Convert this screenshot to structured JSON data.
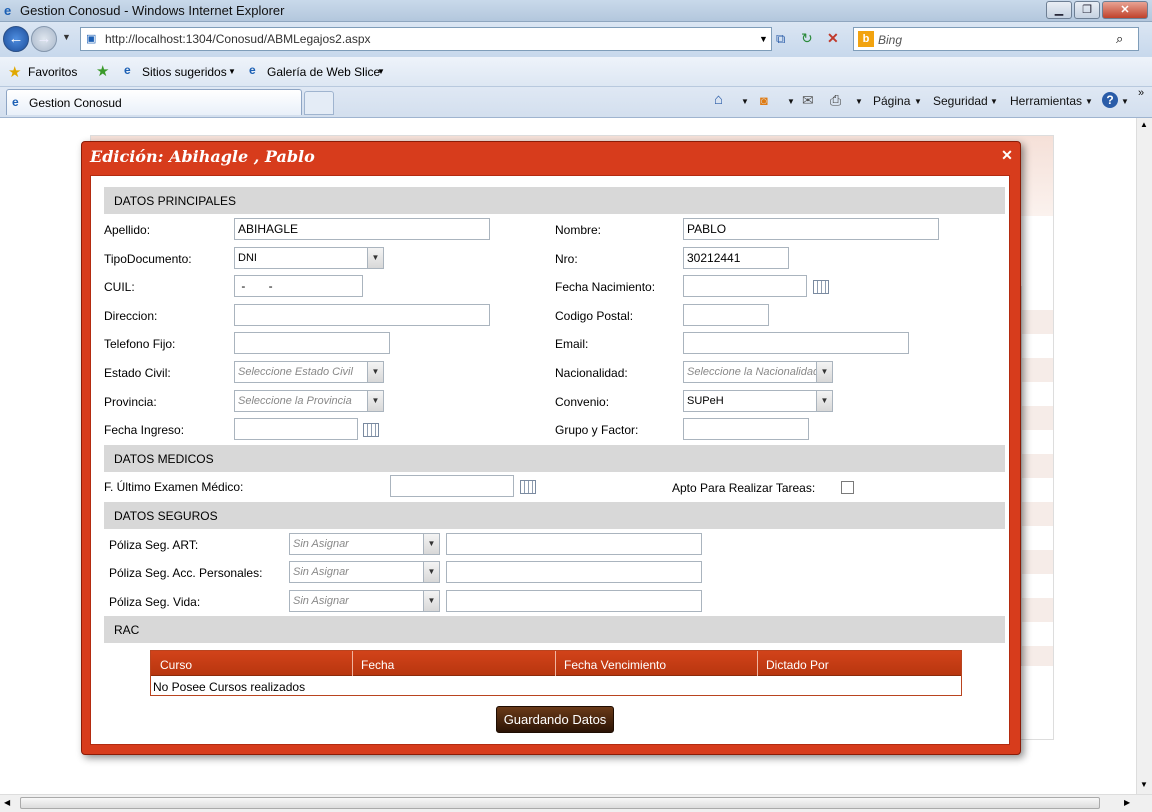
{
  "browser": {
    "window_title": "Gestion Conosud - Windows Internet Explorer",
    "url": "http://localhost:1304/Conosud/ABMLegajos2.aspx",
    "search_placeholder": "Bing",
    "favorites_label": "Favoritos",
    "favlinks": [
      "Sitios sugeridos",
      "Galería de Web Slice"
    ],
    "tab_title": "Gestion Conosud",
    "commands": [
      "Página",
      "Seguridad",
      "Herramientas"
    ]
  },
  "dialog": {
    "title": "Edición: Abihagle , Pablo",
    "sections": {
      "principales": "DATOS PRINCIPALES",
      "medicos": "DATOS MEDICOS",
      "seguros": "DATOS SEGUROS",
      "rac": "RAC"
    },
    "labels": {
      "apellido": "Apellido:",
      "nombre": "Nombre:",
      "tipo_doc": "TipoDocumento:",
      "nro": "Nro:",
      "cuil": "CUIL:",
      "fecha_nac": "Fecha Nacimiento:",
      "direccion": "Direccion:",
      "cp": "Codigo Postal:",
      "telefono": "Telefono Fijo:",
      "email": "Email:",
      "estado_civil": "Estado Civil:",
      "nacionalidad": "Nacionalidad:",
      "provincia": "Provincia:",
      "convenio": "Convenio:",
      "fecha_ingreso": "Fecha Ingreso:",
      "grupo": "Grupo y Factor:",
      "examen": "F. Último Examen Médico:",
      "apto": "Apto Para Realizar Tareas:",
      "poliza_art": "Póliza Seg. ART:",
      "poliza_acc": "Póliza Seg. Acc. Personales:",
      "poliza_vida": "Póliza Seg. Vida:"
    },
    "values": {
      "apellido": "ABIHAGLE",
      "nombre": "PABLO",
      "tipo_doc": "DNI",
      "nro": "30212441",
      "cuil": " -       -",
      "convenio": "SUPeH"
    },
    "placeholders": {
      "estado_civil": "Seleccione Estado Civil",
      "nacionalidad": "Seleccione la Nacionalidad",
      "provincia": "Seleccione la Provincia",
      "sin_asignar": "Sin Asignar"
    },
    "grid": {
      "headers": [
        "Curso",
        "Fecha",
        "Fecha Vencimiento",
        "Dictado Por"
      ],
      "empty": "No Posee Cursos realizados"
    },
    "save_label": "Guardando Datos"
  }
}
